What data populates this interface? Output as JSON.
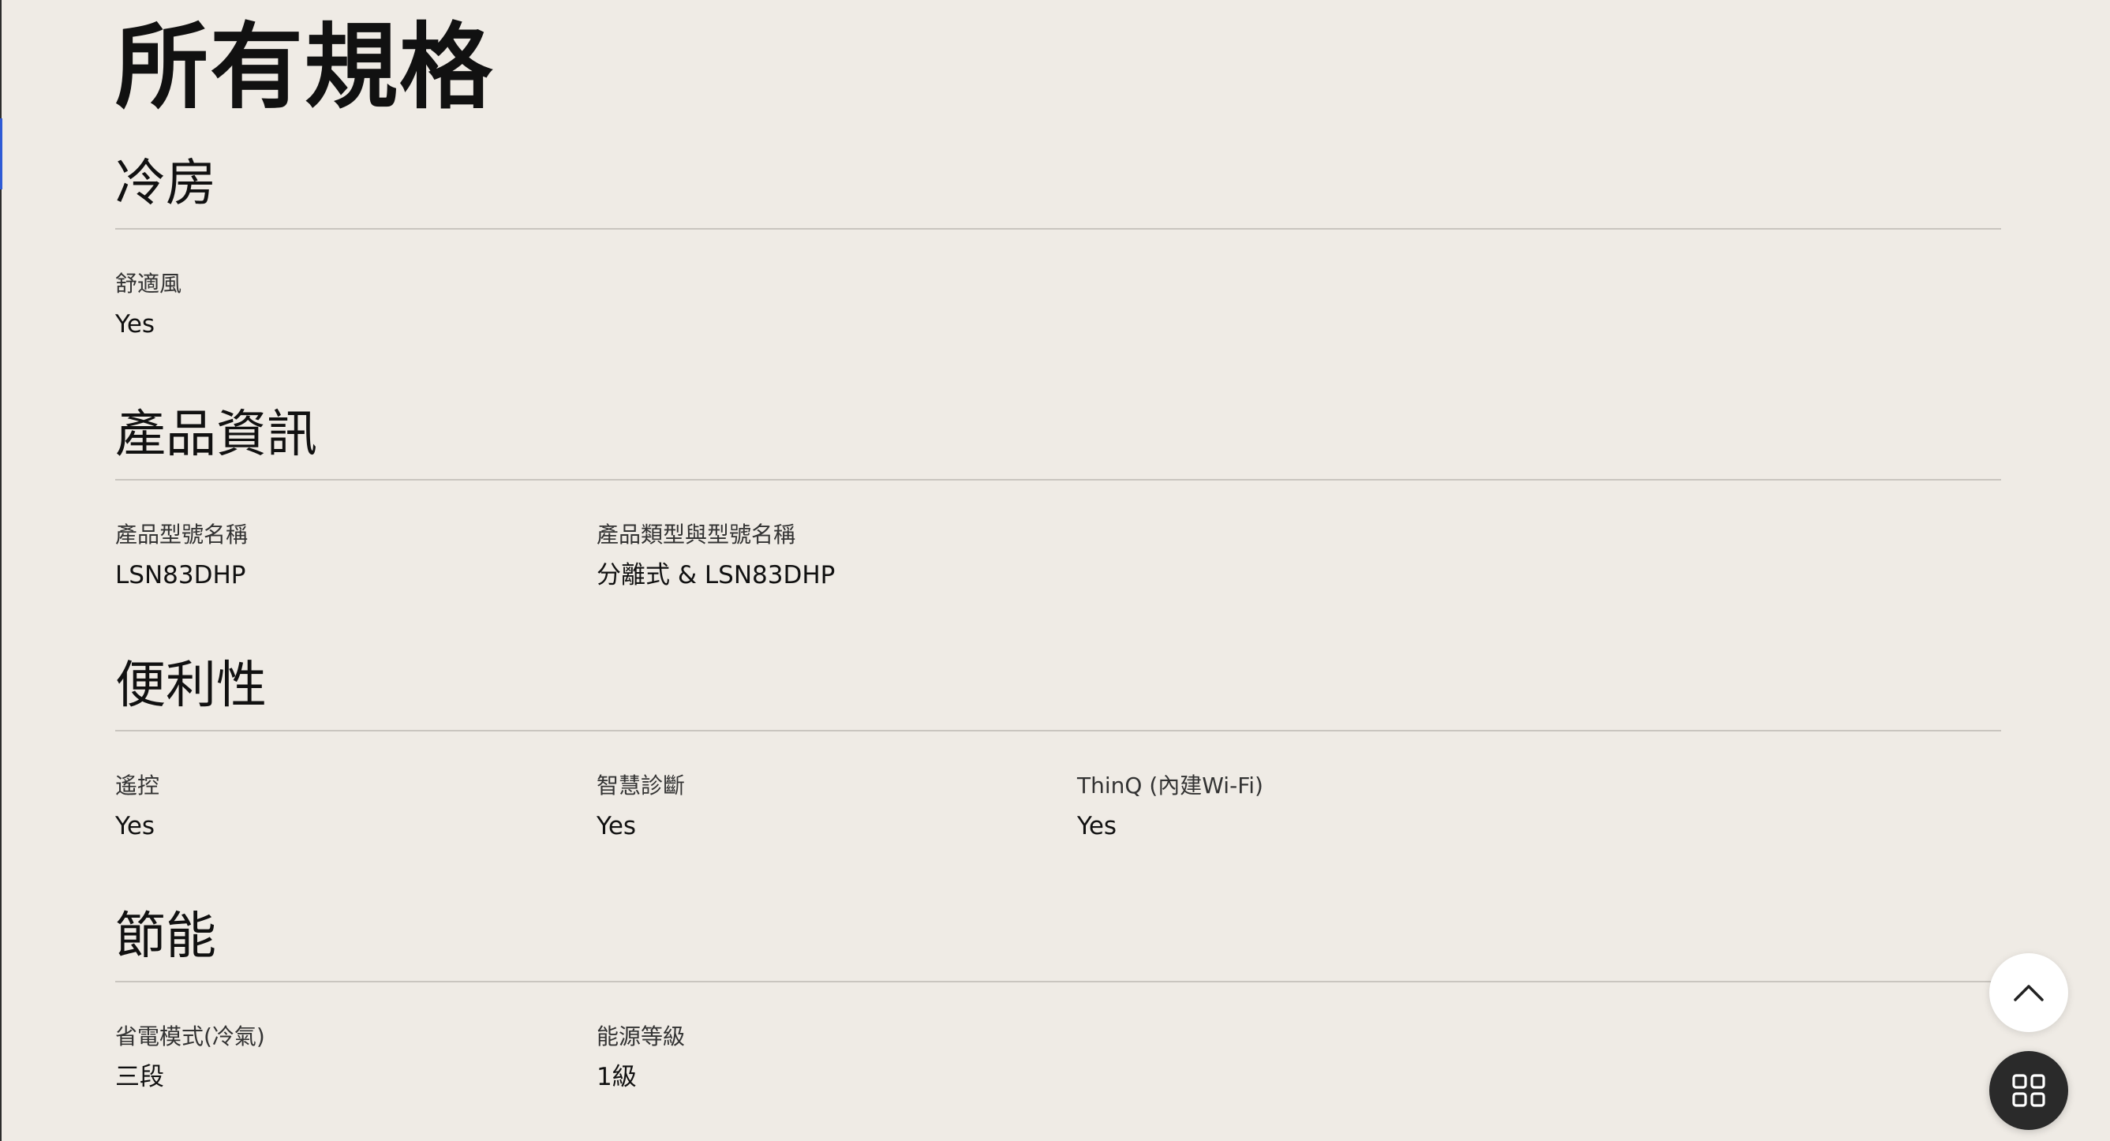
{
  "page": {
    "title": "所有規格"
  },
  "sections": [
    {
      "title": "冷房",
      "specs": [
        {
          "label": "舒適風",
          "value": "Yes"
        }
      ]
    },
    {
      "title": "產品資訊",
      "specs": [
        {
          "label": "產品型號名稱",
          "value": "LSN83DHP"
        },
        {
          "label": "產品類型與型號名稱",
          "value": "分離式 & LSN83DHP"
        }
      ]
    },
    {
      "title": "便利性",
      "specs": [
        {
          "label": "遙控",
          "value": "Yes"
        },
        {
          "label": "智慧診斷",
          "value": "Yes"
        },
        {
          "label": "ThinQ (內建Wi-Fi)",
          "value": "Yes"
        }
      ]
    },
    {
      "title": "節能",
      "specs": [
        {
          "label": "省電模式(冷氣)",
          "value": "三段"
        },
        {
          "label": "能源等級",
          "value": "1級"
        }
      ]
    }
  ],
  "floating_buttons": {
    "scroll_top_icon": "chevron-up-icon",
    "menu_icon": "grid-icon"
  },
  "colors": {
    "background": "#efebe5",
    "divider": "#c9c5bf",
    "menu_button": "#2a2a2a"
  }
}
